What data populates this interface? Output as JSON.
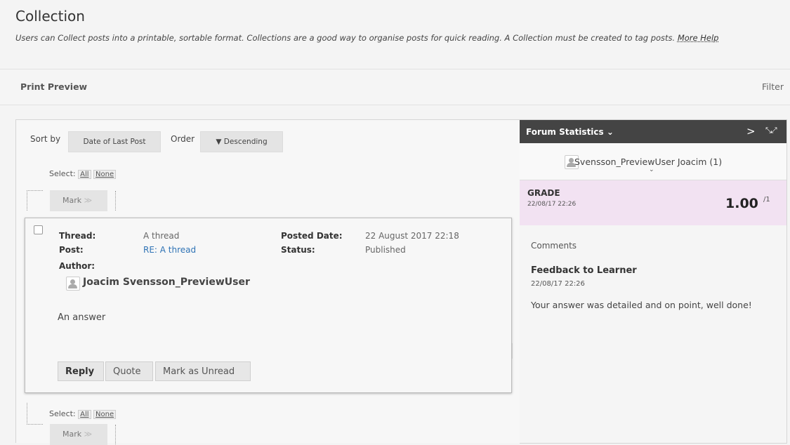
{
  "header": {
    "title": "Collection",
    "description": "Users can Collect posts into a printable, sortable format. Collections are a good way to organise posts for quick reading. A Collection must be created to tag posts.",
    "more_help": "More Help"
  },
  "toolbar": {
    "print_preview": "Print Preview",
    "filter": "Filter"
  },
  "sort": {
    "sort_by_label": "Sort by",
    "sort_by_value": "Date of Last Post",
    "order_label": "Order",
    "order_value": "▼ Descending"
  },
  "select": {
    "label": "Select:",
    "all": "All",
    "none": "None"
  },
  "mark": {
    "label": "Mark",
    "chevron": "≫"
  },
  "post": {
    "thread_label": "Thread:",
    "thread_value": "A thread",
    "post_label": "Post:",
    "post_value": "RE: A thread",
    "author_label": "Author:",
    "author_name": "Joacim Svensson_PreviewUser",
    "posted_date_label": "Posted Date:",
    "posted_date_value": "22 August 2017 22:18",
    "status_label": "Status:",
    "status_value": "Published",
    "body": "An answer",
    "actions": {
      "reply": "Reply",
      "quote": "Quote",
      "mark_unread": "Mark as Unread"
    }
  },
  "side_panel": {
    "title": "Forum Statistics ⌄",
    "next_icon": "chevron-right-icon",
    "expand_icon": "expand-icon",
    "user": "Svensson_PreviewUser Joacim (1)",
    "grade_label": "GRADE",
    "grade_date": "22/08/17 22:26",
    "grade_score": "1.00",
    "grade_max": "/1",
    "comments_heading": "Comments",
    "feedback_title": "Feedback to Learner",
    "feedback_date": "22/08/17 22:26",
    "feedback_text": "Your answer was detailed and on point, well done!"
  },
  "colors": {
    "link": "#2f73b5",
    "side_header_bg": "#444444",
    "grade_bg": "#f2e2f2"
  }
}
